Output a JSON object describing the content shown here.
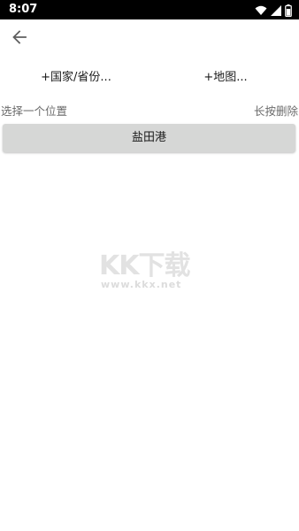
{
  "status_bar": {
    "time": "8:07",
    "icons": [
      "wifi-icon",
      "signal-icon",
      "battery-icon"
    ]
  },
  "toolbar": {
    "back_icon": "arrow-left-icon"
  },
  "actions": {
    "add_country_label": "+国家/省份...",
    "add_map_label": "+地图..."
  },
  "hints": {
    "select_location": "选择一个位置",
    "long_press_delete": "长按删除"
  },
  "locations": [
    {
      "name": "盐田港"
    }
  ],
  "watermark": {
    "logo_text": "KK下载",
    "url": "www.kkx.net"
  },
  "colors": {
    "status_bar_bg": "#000000",
    "item_bg": "#d6d7d6",
    "hint_text": "#6b6b6b"
  }
}
